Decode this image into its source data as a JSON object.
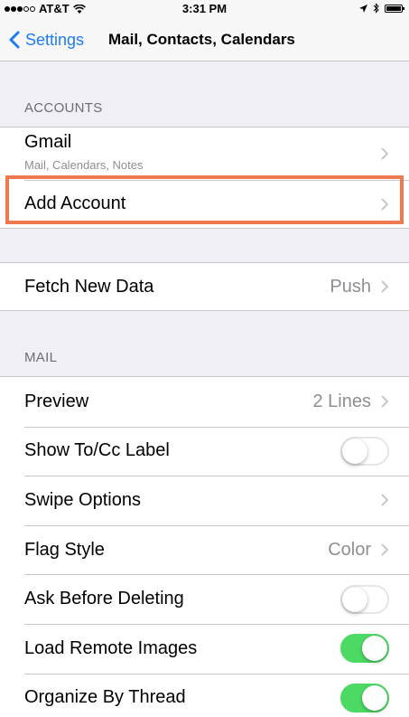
{
  "status_bar": {
    "carrier": "AT&T",
    "time": "3:31 PM",
    "signal_icon": "signal-dots-icon",
    "wifi_icon": "wifi-icon",
    "location_icon": "location-arrow-icon",
    "bluetooth_icon": "bluetooth-icon",
    "battery_icon": "battery-icon"
  },
  "nav": {
    "back_label": "Settings",
    "title": "Mail, Contacts, Calendars"
  },
  "accounts": {
    "header": "ACCOUNTS",
    "gmail_name": "Gmail",
    "gmail_services": "Mail, Calendars, Notes",
    "add_account": "Add Account"
  },
  "fetch": {
    "label": "Fetch New Data",
    "value": "Push"
  },
  "mail": {
    "header": "MAIL",
    "preview_label": "Preview",
    "preview_value": "2 Lines",
    "show_tocc_label": "Show To/Cc Label",
    "show_tocc_on": false,
    "swipe_label": "Swipe Options",
    "flag_label": "Flag Style",
    "flag_value": "Color",
    "ask_delete_label": "Ask Before Deleting",
    "ask_delete_on": false,
    "load_images_label": "Load Remote Images",
    "load_images_on": true,
    "organize_label": "Organize By Thread",
    "organize_on": true
  },
  "colors": {
    "accent": "#1e7cf2",
    "toggle_on": "#4cd964",
    "highlight": "#f07a4f",
    "background": "#efeff4"
  }
}
